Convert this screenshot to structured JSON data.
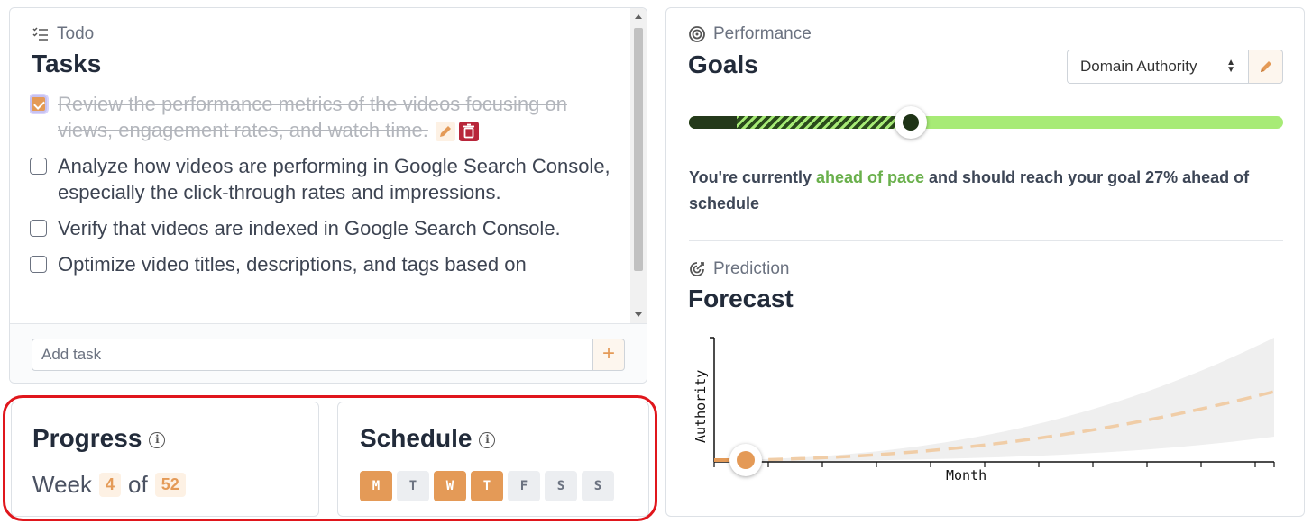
{
  "todo": {
    "section_label": "Todo",
    "title": "Tasks",
    "tasks": [
      {
        "text": "Review the performance metrics of the videos focusing on views, engagement rates, and watch time.",
        "done": true
      },
      {
        "text": "Analyze how videos are performing in Google Search Console, especially the click-through rates and impressions.",
        "done": false
      },
      {
        "text": "Verify that videos are indexed in Google Search Console.",
        "done": false
      },
      {
        "text": "Optimize video titles, descriptions, and tags based on",
        "done": false
      }
    ],
    "add_placeholder": "Add task",
    "add_button": "+"
  },
  "progress": {
    "title": "Progress",
    "info": "i",
    "week_label": "Week",
    "of_label": "of",
    "current_week": "4",
    "total_weeks": "52"
  },
  "schedule": {
    "title": "Schedule",
    "info": "i",
    "days": [
      {
        "label": "M",
        "active": true
      },
      {
        "label": "T",
        "active": false
      },
      {
        "label": "W",
        "active": true
      },
      {
        "label": "T",
        "active": true
      },
      {
        "label": "F",
        "active": false
      },
      {
        "label": "S",
        "active": false
      },
      {
        "label": "S",
        "active": false
      }
    ]
  },
  "performance": {
    "section_label": "Performance",
    "title": "Goals",
    "goal_select": "Domain Authority",
    "goal_progress": {
      "solid": 0.08,
      "current": 0.374
    },
    "pace": {
      "prefix": "You're currently ",
      "highlight": "ahead of pace",
      "suffix": " and should reach your goal 27% ahead of schedule"
    }
  },
  "prediction": {
    "section_label": "Prediction",
    "title": "Forecast",
    "chart": {
      "ylabel": "Authority",
      "xlabel": "Month"
    }
  },
  "colors": {
    "accent": "#e49a57",
    "goal_light": "#a7eb76",
    "goal_dark": "#24391a",
    "pace_green": "#6ab04c",
    "highlight_box": "#e0161c"
  }
}
